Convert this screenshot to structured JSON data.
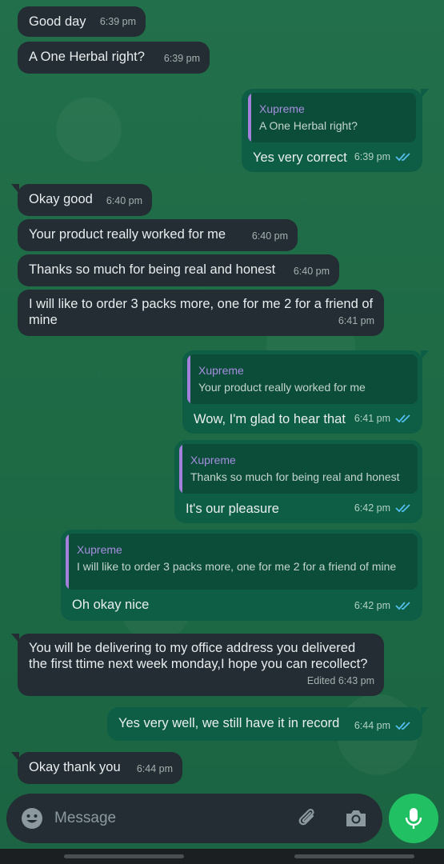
{
  "sender_name": "Xupreme",
  "input": {
    "placeholder": "Message"
  },
  "colors": {
    "incoming": "#232d33",
    "outgoing": "#0d5e45",
    "ticks_read": "#53bdeb",
    "mic": "#21c063"
  },
  "messages": [
    {
      "dir": "in",
      "text": "Good day",
      "time": "6:39 pm"
    },
    {
      "dir": "in",
      "text": "A One Herbal right?",
      "time": "6:39 pm"
    },
    {
      "dir": "out",
      "quote_name": "Xupreme",
      "quote_text": "A One Herbal right?",
      "text": "Yes very correct",
      "time": "6:39 pm",
      "status": "read"
    },
    {
      "dir": "in",
      "text": "Okay good",
      "time": "6:40 pm"
    },
    {
      "dir": "in",
      "text": "Your product really worked for me",
      "time": "6:40 pm"
    },
    {
      "dir": "in",
      "text": "Thanks so much for being real and honest",
      "time": "6:40 pm"
    },
    {
      "dir": "in",
      "text": "I will like to order 3 packs more, one for me 2 for a friend of mine",
      "time": "6:41 pm"
    },
    {
      "dir": "out",
      "quote_name": "Xupreme",
      "quote_text": "Your product really worked for me",
      "text": "Wow, I'm glad to hear that",
      "time": "6:41 pm",
      "status": "read"
    },
    {
      "dir": "out",
      "quote_name": "Xupreme",
      "quote_text": "Thanks so much for being real and honest",
      "text": "It's our pleasure",
      "time": "6:42 pm",
      "status": "read"
    },
    {
      "dir": "out",
      "quote_name": "Xupreme",
      "quote_text": "I will like to order 3 packs more, one for me 2 for a friend of mine",
      "text": "Oh okay nice",
      "time": "6:42 pm",
      "status": "read"
    },
    {
      "dir": "in",
      "text": "You will be delivering to my office address you delivered the first ttime next week monday,I hope you can recollect?",
      "time": "Edited 6:43 pm"
    },
    {
      "dir": "out",
      "text": "Yes very well, we still have it in record",
      "time": "6:44 pm",
      "status": "read"
    },
    {
      "dir": "in",
      "text": "Okay thank you",
      "time": "6:44 pm"
    }
  ]
}
